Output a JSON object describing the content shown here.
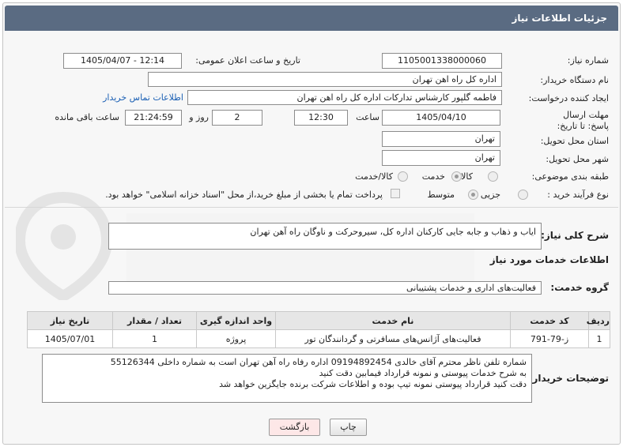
{
  "header": {
    "title": "جزئیات اطلاعات نیاز"
  },
  "form": {
    "need_number": {
      "label": "شماره نیاز:",
      "value": "1105001338000060"
    },
    "announce": {
      "label": "تاریخ و ساعت اعلان عمومی:",
      "value": "1405/04/07 - 12:14"
    },
    "buyer_org": {
      "label": "نام دستگاه خریدار:",
      "value": "اداره کل راه اهن تهران"
    },
    "requester": {
      "label": "ایجاد کننده درخواست:",
      "value": "فاطمه گلپور کارشناس تدارکات اداره کل راه اهن تهران",
      "contact_link": "اطلاعات تماس خریدار"
    },
    "deadline": {
      "label": "مهلت ارسال پاسخ: تا تاریخ:",
      "date": "1405/04/10",
      "time_label": "ساعت",
      "time": "12:30",
      "days": "2",
      "days_label": "روز و",
      "remaining": "21:24:59",
      "remaining_label": "ساعت باقی مانده"
    },
    "province": {
      "label": "استان محل تحویل:",
      "value": "تهران"
    },
    "city": {
      "label": "شهر محل تحویل:",
      "value": "تهران"
    },
    "category": {
      "label": "طبقه بندی موضوعی:",
      "options": [
        "کالا",
        "خدمت",
        "کالا/خدمت"
      ],
      "selected": "خدمت"
    },
    "purchase_type": {
      "label": "نوع فرآیند خرید :",
      "options": [
        "جزیی",
        "متوسط"
      ],
      "selected": "متوسط",
      "checkbox_text": "پرداخت تمام یا بخشی از مبلغ خرید،از محل \"اسناد خزانه اسلامی\" خواهد بود."
    }
  },
  "summary": {
    "label": "شرح کلی نیاز:",
    "value": "ایاب و ذهاب و جابه جایی کارکنان اداره کل، سیروحرکت و ناوگان راه آهن تهران"
  },
  "services": {
    "section_title": "اطلاعات خدمات مورد نیاز",
    "group_label": "گروه خدمت:",
    "group_value": "فعالیت‌های اداری و خدمات پشتیبانی",
    "columns": [
      "ردیف",
      "کد خدمت",
      "نام خدمت",
      "واحد اندازه گیری",
      "تعداد / مقدار",
      "تاریخ نیاز"
    ],
    "rows": [
      {
        "row": "1",
        "code": "ز-79-791",
        "name": "فعالیت‌های آژانس‌های مسافرتی و گردانندگان تور",
        "unit": "پروژه",
        "qty": "1",
        "date": "1405/07/01"
      }
    ]
  },
  "notes": {
    "label": "توضیحات خریدار:",
    "lines": [
      "شماره تلفن ناظر محترم آقای خالدی 09194892454 اداره رفاه راه آهن تهران است به شماره داخلی 55126344",
      "به شرح خدمات پیوستی و نمونه قرارداد فیمابین دقت کنید",
      "دقت کنید قرارداد پیوستی نمونه تیپ بوده و اطلاعات شرکت برنده جایگزین خواهد شد"
    ]
  },
  "buttons": {
    "print": "چاپ",
    "back": "بازگشت"
  },
  "colors": {
    "header_bg": "#5a6b82",
    "link": "#1a5fb4",
    "back_button_bg": "#fde7e7",
    "watermark": "#e4e4e4"
  }
}
